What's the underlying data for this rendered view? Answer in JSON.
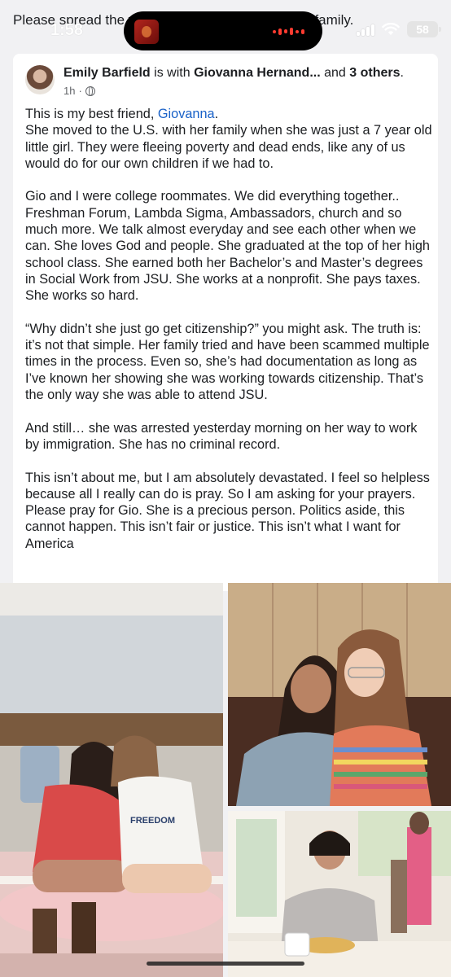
{
  "share_caption": "Please spread the word and pray for her and her family.",
  "status_bar": {
    "time": "1:58",
    "battery": "58"
  },
  "post": {
    "author": "Emily Barfield",
    "with_text": "is with",
    "tagged_person": "Giovanna Hernand...",
    "and_text": "and",
    "others": "3 others",
    "time_ago": "1h",
    "audience_icon": "globe-icon",
    "paragraphs": [
      {
        "lead": "This is my best friend, ",
        "mention": "Giovanna",
        "trail": ".\nShe moved to the U.S. with her family when she was just a 7 year old little girl. They were fleeing poverty and dead ends, like any of us would do for our own children if we had to."
      },
      {
        "text": "Gio and I were college roommates. We did everything together.. Freshman Forum, Lambda Sigma, Ambassadors, church and so much more. We talk almost everyday and see each other when we can. She loves God and people. She graduated at the top of her high school class. She earned both her Bachelor’s and Master’s degrees in Social Work from JSU. She works at a nonprofit. She pays taxes. She works so hard."
      },
      {
        "text": "“Why didn’t she just go get citizenship?” you might ask. The truth is: it’s not that simple. Her family tried and have been scammed multiple times in the process. Even so, she’s had documentation as long as I’ve known her showing she was working towards citizenship. That’s the only way she was able to attend JSU."
      },
      {
        "text": "And still… she was arrested yesterday morning on her way to work by immigration. She has no criminal record."
      },
      {
        "text": "This isn’t about me, but I am absolutely devastated. I feel so helpless because all I really can do is pray. So I am asking for your prayers. Please pray for Gio. She is a precious person. Politics aside, this cannot happen. This isn’t fair or justice. This isn’t what I want for America"
      }
    ]
  },
  "photos": {
    "left_shirt_text": "FREEDOM"
  }
}
